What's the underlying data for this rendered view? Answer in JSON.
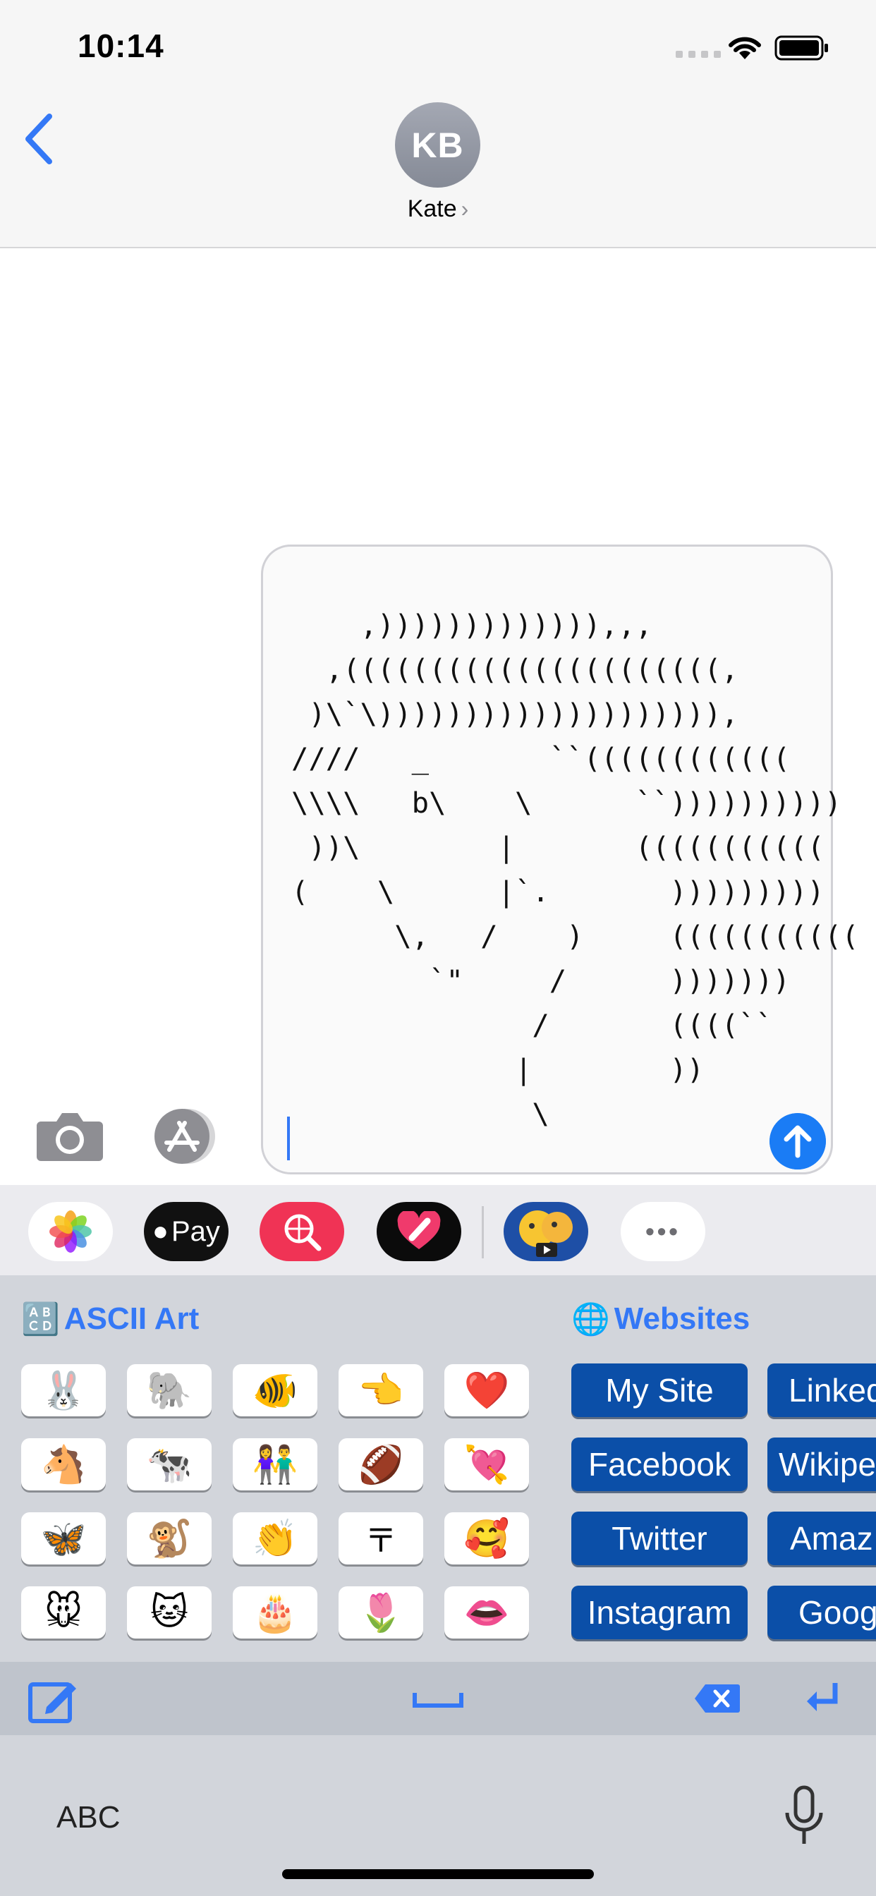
{
  "status": {
    "time": "10:14"
  },
  "header": {
    "avatar_initials": "KB",
    "contact_name": "Kate",
    "contact_chevron": "›"
  },
  "message": {
    "ascii_art": "    ,))))))))))))),,,\n  ,((((((((((((((((((((((,\n )\\`\\)))))))))))))))))))),\n////   _       ``((((((((((((\n\\\\\\\\   b\\    \\      ``))))))))))\n ))\\        |       (((((((((((\n(    \\      |`.       )))))))))\n      \\,   /    )     (((((((((((\n        `\"     /      )))))))\n              /       ((((``\n             |        ))\n              \\"
  },
  "drawer": {
    "apps": [
      {
        "name": "photos",
        "icon": "✿"
      },
      {
        "name": "apple-pay",
        "label": "Pay",
        "icon": ""
      },
      {
        "name": "search-images",
        "icon": "⊕"
      },
      {
        "name": "digital-touch",
        "icon": "♥"
      },
      {
        "name": "memoji",
        "icon": "🤩"
      },
      {
        "name": "more",
        "icon": "•••"
      }
    ]
  },
  "keyboard": {
    "ascii_section": {
      "icon": "🔠",
      "title": "ASCII Art"
    },
    "websites_section": {
      "icon": "🌐",
      "title": "Websites"
    },
    "emoji_keys": [
      [
        "🐰",
        "🐘",
        "🐠",
        "👈",
        "❤️"
      ],
      [
        "🐴",
        "🐄",
        "👫",
        "🏈",
        "💘"
      ],
      [
        "🦋",
        "🐒",
        "👏",
        "〒",
        "🥰"
      ],
      [
        "🐭",
        "🐱",
        "🎂",
        "🌷",
        "👄"
      ]
    ],
    "website_keys": [
      [
        "My Site",
        "Linked"
      ],
      [
        "Facebook",
        "Wikipe"
      ],
      [
        "Twitter",
        "Amaz"
      ],
      [
        "Instagram",
        "Goog"
      ]
    ]
  },
  "bottom": {
    "abc_label": "ABC"
  },
  "colors": {
    "accent": "#3478f6",
    "send": "#1a7cf5",
    "web_key": "#0b4fa8"
  }
}
